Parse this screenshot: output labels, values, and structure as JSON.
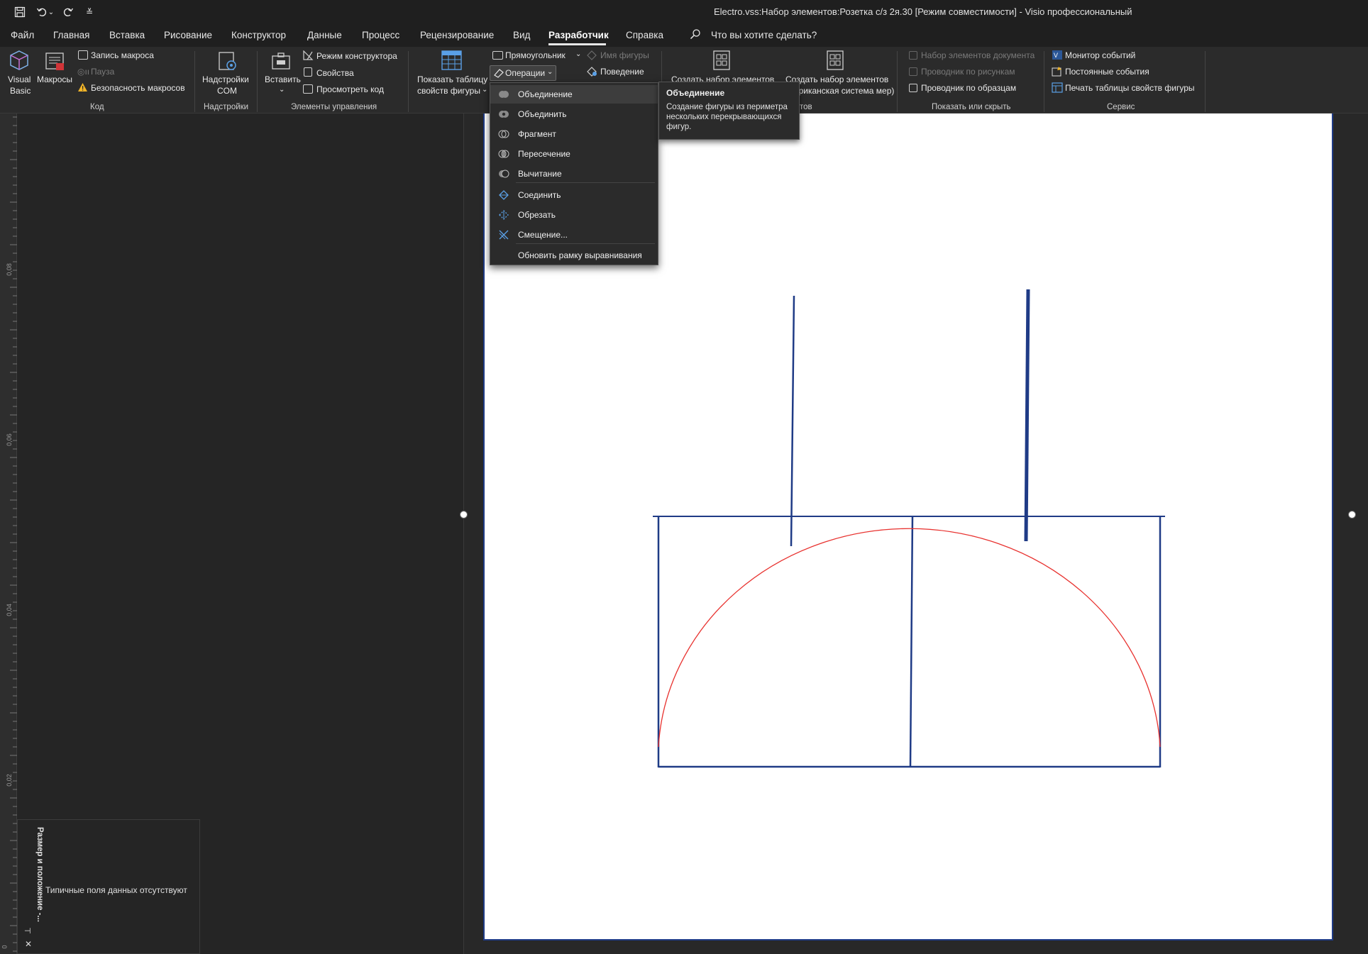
{
  "window": {
    "title": "Electro.vss:Набор элементов:Розетка с/з 2я.30  [Режим совместимости]  -  Visio профессиональный"
  },
  "quick_access": {
    "save_icon": "save-icon",
    "undo_icon": "undo-icon",
    "redo_icon": "redo-icon",
    "customize_icon": "customize-icon"
  },
  "menu": {
    "tabs": [
      "Файл",
      "Главная",
      "Вставка",
      "Рисование",
      "Конструктор",
      "Данные",
      "Процесс",
      "Рецензирование",
      "Вид",
      "Разработчик",
      "Справка"
    ],
    "active_tab": "Разработчик",
    "search_placeholder": "Что вы хотите сделать?"
  },
  "ribbon": {
    "code": {
      "visual_basic_line1": "Visual",
      "visual_basic_line2": "Basic",
      "macros": "Макросы",
      "record_macro": "Запись макроса",
      "pause": "Пауза",
      "macro_security": "Безопасность макросов",
      "group_label": "Код"
    },
    "addins": {
      "com_line1": "Надстройки",
      "com_line2": "COM",
      "group_label": "Надстройки"
    },
    "controls": {
      "insert": "Вставить",
      "design_mode": "Режим конструктора",
      "properties": "Свойства",
      "view_code": "Просмотреть код",
      "group_label": "Элементы управления"
    },
    "shape_design": {
      "show_sheet_line1": "Показать таблицу",
      "show_sheet_line2": "свойств фигуры",
      "rectangle": "Прямоугольник",
      "operations": "Операции",
      "shape_name": "Имя фигуры",
      "behavior": "Поведение"
    },
    "stencil": {
      "new_stencil_1": "Создать набор элементов",
      "new_stencil_2_line1": "Создать набор элементов",
      "new_stencil_2_line2": "(американская система мер)",
      "group_label_tail": "тов"
    },
    "show_hide": {
      "document_stencil": "Набор элементов документа",
      "drawing_explorer": "Проводник по рисункам",
      "master_explorer": "Проводник по образцам",
      "group_label": "Показать или скрыть"
    },
    "tools": {
      "event_monitor": "Монитор событий",
      "persistent_events": "Постоянные события",
      "print_shapesheet": "Печать таблицы свойств фигуры",
      "group_label": "Сервис"
    }
  },
  "operations_menu": {
    "items": [
      {
        "label": "Объединение",
        "icon": "union-icon"
      },
      {
        "label": "Объединить",
        "icon": "combine-icon"
      },
      {
        "label": "Фрагмент",
        "icon": "fragment-icon"
      },
      {
        "label": "Пересечение",
        "icon": "intersect-icon"
      },
      {
        "label": "Вычитание",
        "icon": "subtract-icon"
      },
      {
        "label": "Соединить",
        "icon": "join-icon"
      },
      {
        "label": "Обрезать",
        "icon": "trim-icon"
      },
      {
        "label": "Смещение...",
        "icon": "offset-icon"
      },
      {
        "label": "Обновить рамку выравнивания",
        "icon": ""
      }
    ],
    "highlighted": "Объединение"
  },
  "tooltip": {
    "title": "Объединение",
    "body": "Создание фигуры из периметра нескольких перекрывающихся фигур."
  },
  "ruler": {
    "labels": [
      "0,08",
      "0,06",
      "0,04",
      "0,02",
      "0"
    ]
  },
  "size_panel": {
    "title": "Размер и положение -...",
    "message": "Типичные поля данных отсутствуют",
    "pin_icon": "pin-icon",
    "close_icon": "close-icon"
  },
  "drawing": {
    "frame_color": "#1f3b86",
    "arc_color": "#e8322f"
  }
}
